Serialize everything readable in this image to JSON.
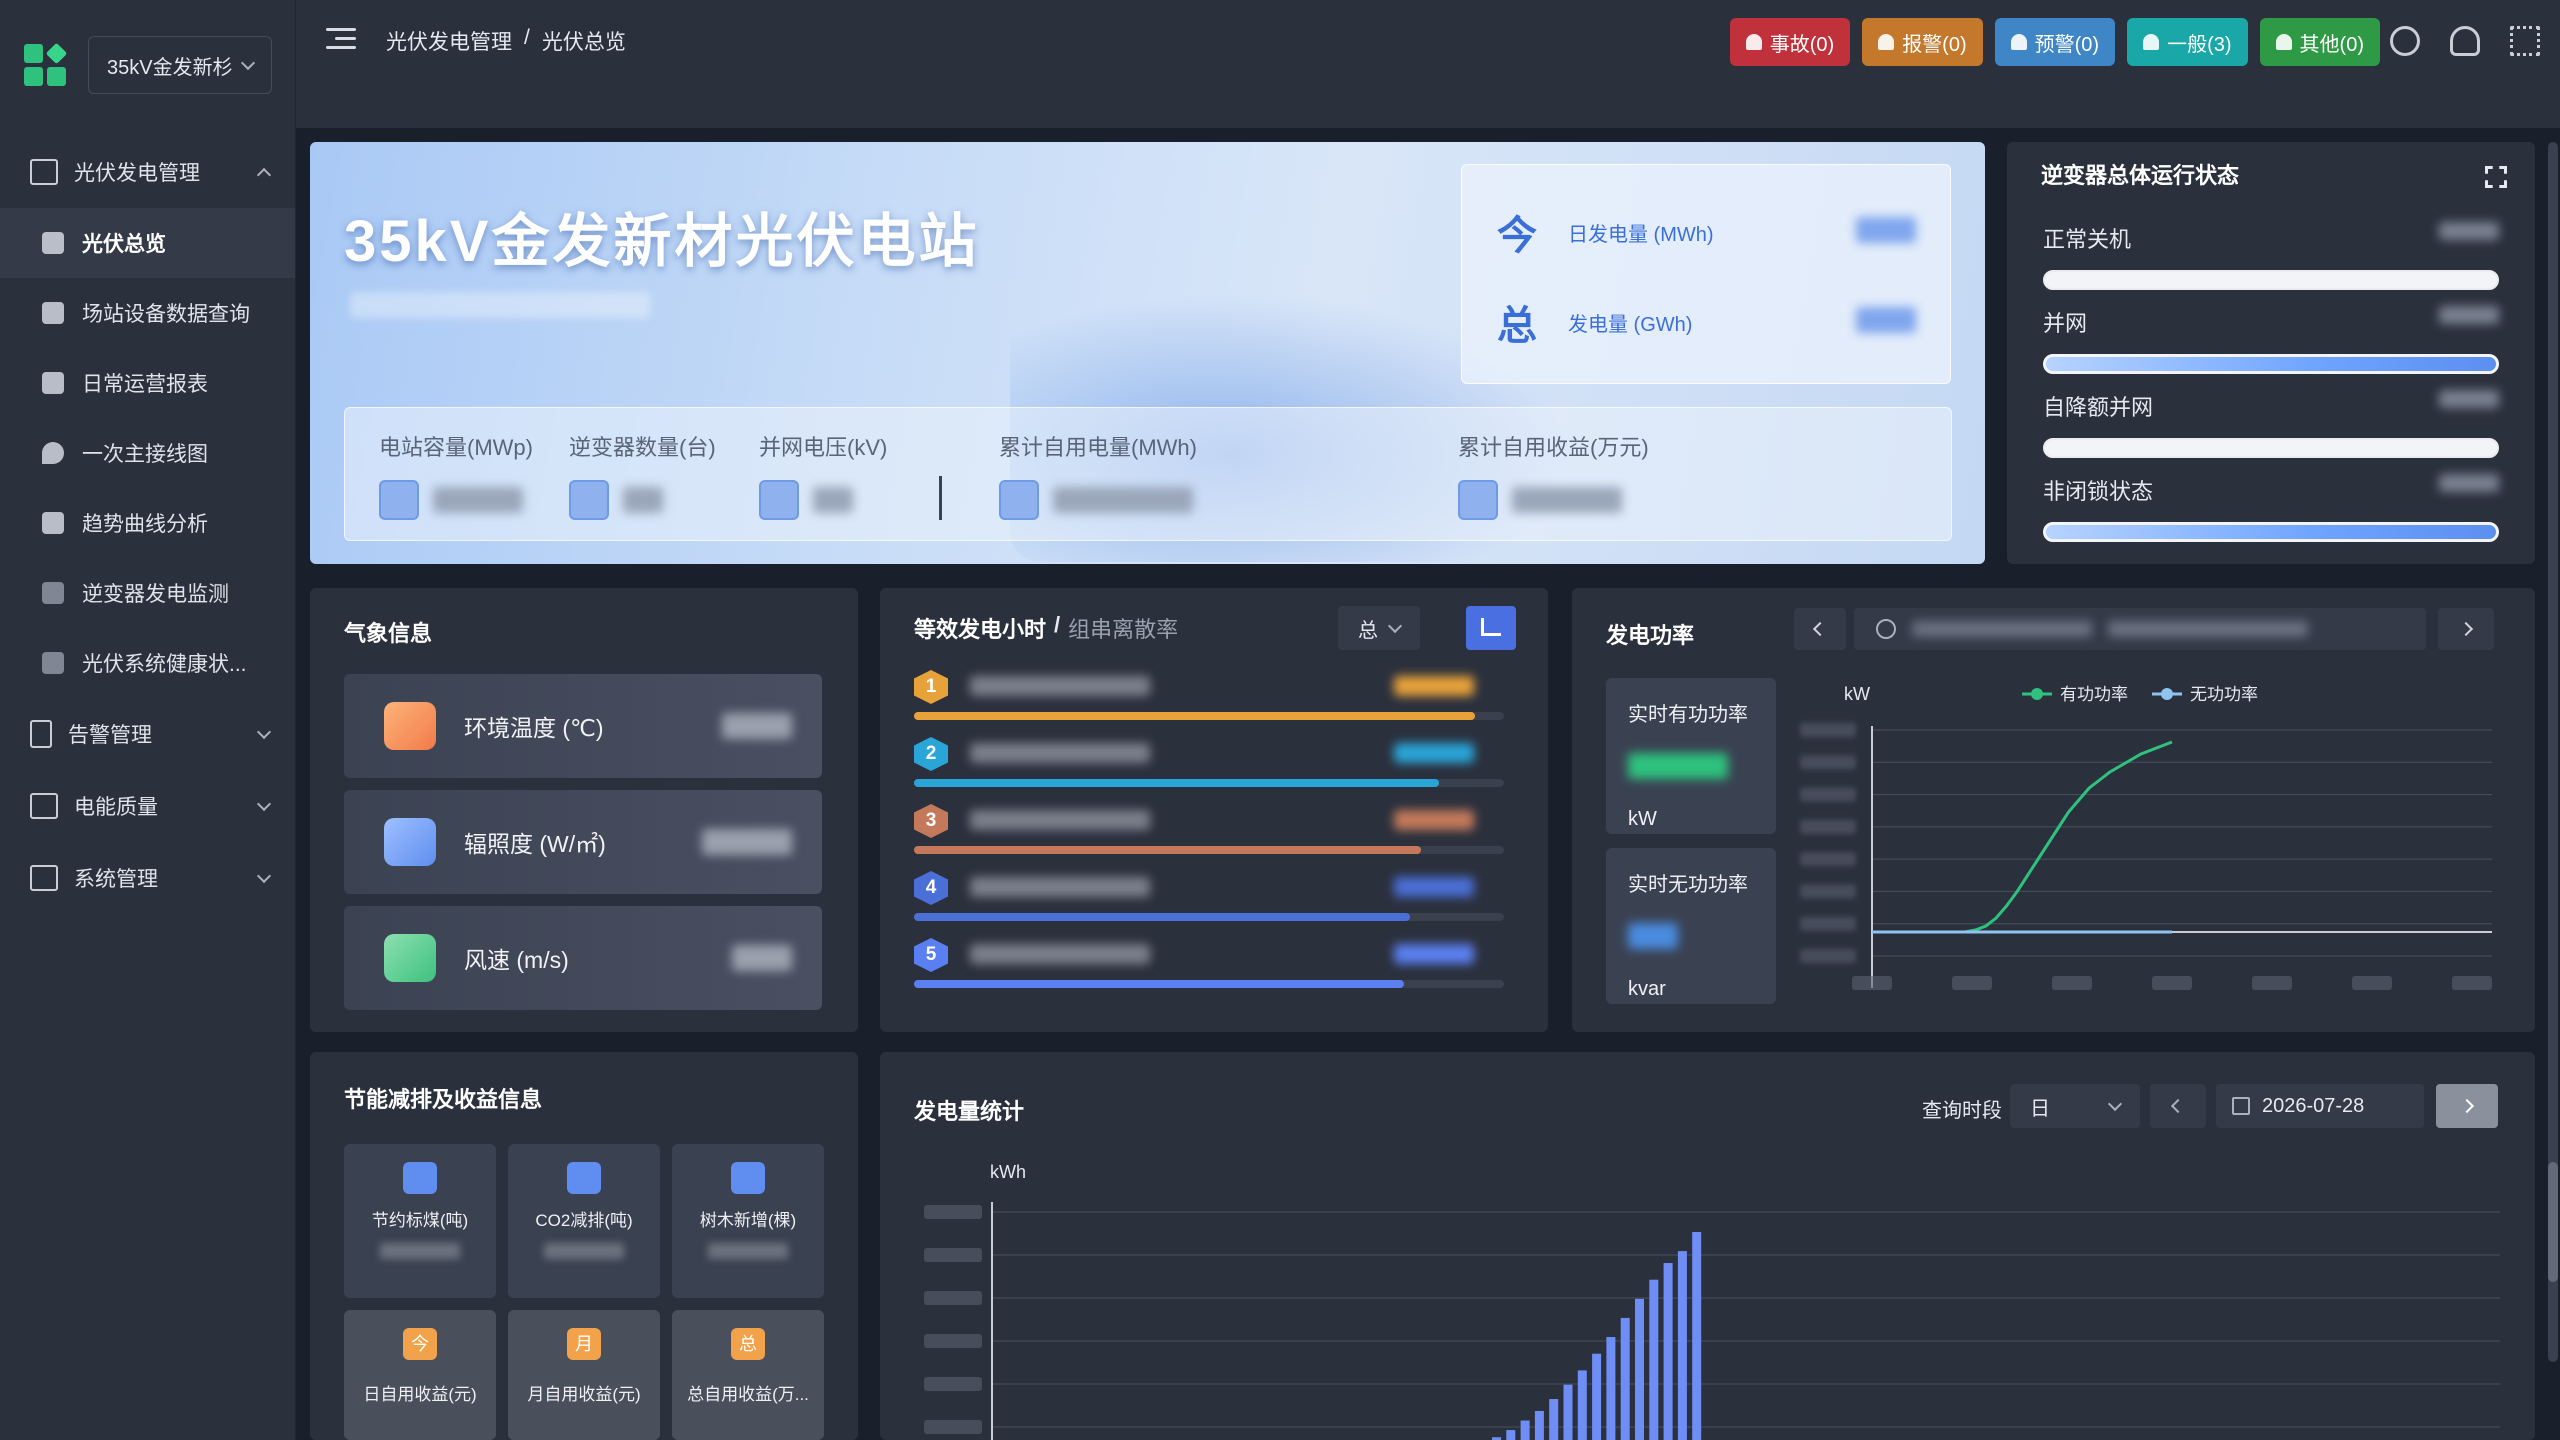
{
  "sidebar": {
    "station_select": "35kV金发新杉",
    "groups": [
      {
        "label": "光伏发电管理",
        "expanded": true
      },
      {
        "label": "告警管理"
      },
      {
        "label": "电能质量"
      },
      {
        "label": "系统管理"
      }
    ],
    "items": [
      {
        "label": "光伏总览",
        "active": true
      },
      {
        "label": "场站设备数据查询"
      },
      {
        "label": "日常运营报表"
      },
      {
        "label": "一次主接线图"
      },
      {
        "label": "趋势曲线分析"
      },
      {
        "label": "逆变器发电监测"
      },
      {
        "label": "光伏系统健康状..."
      }
    ]
  },
  "header": {
    "breadcrumb": [
      "光伏发电管理",
      "/",
      "光伏总览"
    ],
    "alerts": [
      {
        "label": "事故(0)",
        "color": "#c0313b"
      },
      {
        "label": "报警(0)",
        "color": "#c3782c"
      },
      {
        "label": "预警(0)",
        "color": "#3f86c6"
      },
      {
        "label": "一般(3)",
        "color": "#1aa7a7"
      },
      {
        "label": "其他(0)",
        "color": "#2f9a45"
      }
    ]
  },
  "hero": {
    "title": "35kV金发新材光伏电站",
    "today": [
      {
        "glyph": "今",
        "label": "日发电量 (MWh)"
      },
      {
        "glyph": "总",
        "label": "发电量 (GWh)"
      }
    ],
    "stats": [
      {
        "label": "电站容量(MWp)"
      },
      {
        "label": "逆变器数量(台)"
      },
      {
        "label": "并网电压(kV)"
      },
      {
        "label": "累计自用电量(MWh)"
      },
      {
        "label": "累计自用收益(万元)"
      }
    ]
  },
  "inverter": {
    "title": "逆变器总体运行状态",
    "rows": [
      {
        "label": "正常关机",
        "style": "white"
      },
      {
        "label": "并网",
        "style": "blue"
      },
      {
        "label": "自降额并网",
        "style": "white"
      },
      {
        "label": "非闭锁状态",
        "style": "blue"
      }
    ]
  },
  "weather": {
    "title": "气象信息",
    "items": [
      {
        "label": "环境温度 (℃)",
        "color": "#f08a5d"
      },
      {
        "label": "辐照度 (W/㎡)",
        "color": "#5f8ef0"
      },
      {
        "label": "风速 (m/s)",
        "color": "#3ec17e"
      }
    ]
  },
  "ranking": {
    "title": "等效发电小时",
    "divider": "/",
    "subtitle": "组串离散率",
    "select": "总",
    "rows": [
      {
        "rank": "1",
        "color": "#e8a23a",
        "fill": 0.95
      },
      {
        "rank": "2",
        "color": "#2aa5d8",
        "fill": 0.89
      },
      {
        "rank": "3",
        "color": "#c47a5a",
        "fill": 0.86
      },
      {
        "rank": "4",
        "color": "#4a6fd6",
        "fill": 0.84
      },
      {
        "rank": "5",
        "color": "#5a7ff0",
        "fill": 0.83
      }
    ]
  },
  "power": {
    "title": "发电功率",
    "active_label": "实时有功功率",
    "active_unit": "kW",
    "reactive_label": "实时无功功率",
    "reactive_unit": "kvar",
    "legend": [
      "有功功率",
      "无功功率"
    ]
  },
  "saving": {
    "title": "节能减排及收益信息",
    "row1": [
      {
        "label": "节约标煤(吨)",
        "color": "#5f8ef0"
      },
      {
        "label": "CO2减排(吨)",
        "color": "#5f8ef0"
      },
      {
        "label": "树木新增(棵)",
        "color": "#5f8ef0"
      }
    ],
    "row2": [
      {
        "glyph": "今",
        "label": "日自用收益(元)",
        "color": "#f2a24a"
      },
      {
        "glyph": "月",
        "label": "月自用收益(元)",
        "color": "#f2a24a"
      },
      {
        "glyph": "总",
        "label": "总自用收益(万...",
        "color": "#f2a24a"
      }
    ]
  },
  "generation": {
    "title": "发电量统计",
    "query_label": "查询时段",
    "period": "日",
    "date": "2026-07-28"
  },
  "chart_data": [
    {
      "type": "line",
      "title": "",
      "ylabel": "kW",
      "series": [
        {
          "name": "有功功率",
          "color": "#2ec27e",
          "values": [
            0,
            0,
            0,
            0,
            0,
            0,
            0,
            0,
            0,
            0,
            0.01,
            0.03,
            0.07,
            0.13,
            0.2,
            0.28,
            0.36,
            0.44,
            0.52,
            0.6,
            0.66,
            0.72,
            0.76,
            0.8,
            0.83,
            0.86,
            0.89,
            0.91,
            0.93,
            0.95
          ]
        },
        {
          "name": "无功功率",
          "color": "#8fc4f0",
          "values": [
            0,
            0,
            0,
            0,
            0,
            0,
            0,
            0,
            0,
            0,
            0,
            0,
            0,
            0,
            0,
            0,
            0,
            0,
            0,
            0,
            0,
            0,
            0,
            0,
            0,
            0,
            0,
            0,
            0,
            0
          ]
        }
      ]
    },
    {
      "type": "bar",
      "title": "",
      "ylabel": "kWh",
      "values": [
        0.02,
        0.05,
        0.09,
        0.13,
        0.18,
        0.24,
        0.3,
        0.37,
        0.44,
        0.52,
        0.6,
        0.68,
        0.75,
        0.8,
        0.88
      ]
    }
  ]
}
